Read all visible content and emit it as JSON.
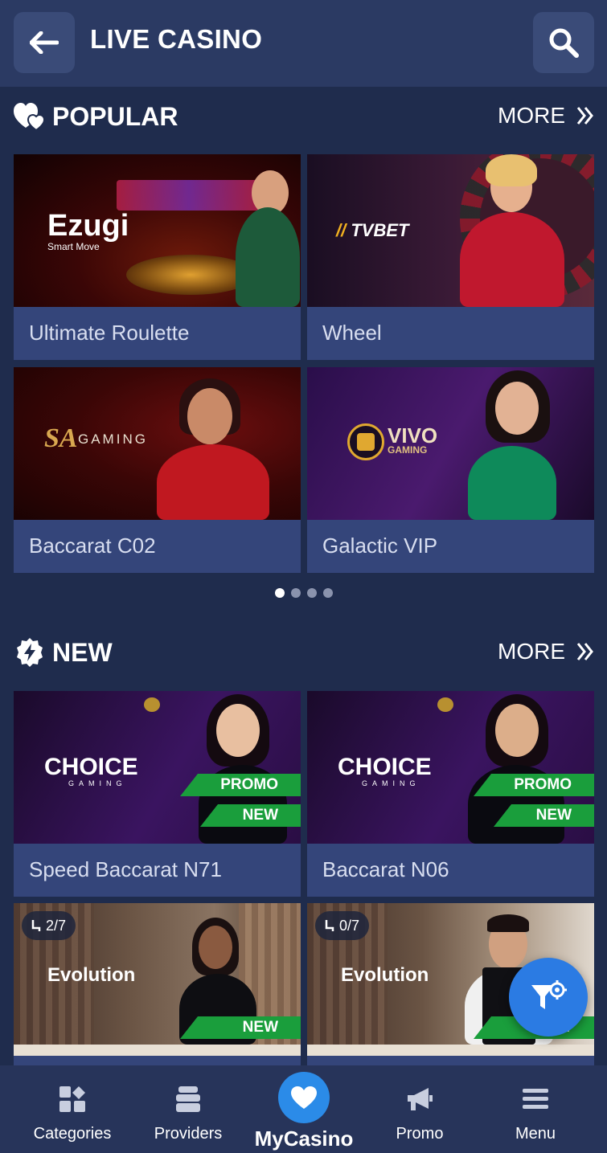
{
  "header": {
    "title": "LIVE CASINO"
  },
  "sections": {
    "popular": {
      "title": "POPULAR",
      "more_label": "MORE",
      "cards": [
        {
          "name": "Ultimate Roulette",
          "provider": "Ezugi",
          "provider_tagline": "Smart Move"
        },
        {
          "name": "Wheel",
          "provider": "TVBET"
        },
        {
          "name": "Baccarat C02",
          "provider": "GAMING",
          "provider_mark": "SA"
        },
        {
          "name": "Galactic VIP",
          "provider": "VIVO",
          "provider_sub": "GAMING"
        }
      ],
      "pagination": {
        "pages": 4,
        "current": 1
      }
    },
    "new": {
      "title": "NEW",
      "more_label": "MORE",
      "cards": [
        {
          "name": "Speed Baccarat N71",
          "provider": "CHOICE",
          "provider_sub": "GAMING",
          "badges": [
            "PROMO",
            "NEW"
          ]
        },
        {
          "name": "Baccarat N06",
          "provider": "CHOICE",
          "provider_sub": "GAMING",
          "badges": [
            "PROMO",
            "NEW"
          ]
        },
        {
          "name": "",
          "provider": "Evolution",
          "seats": "2/7",
          "badges": [
            "NEW"
          ]
        },
        {
          "name": "",
          "provider": "Evolution",
          "seats": "0/7",
          "badges": [
            "NEW"
          ]
        }
      ]
    }
  },
  "bottom_nav": [
    {
      "label": "Categories",
      "icon": "categories-icon"
    },
    {
      "label": "Providers",
      "icon": "providers-icon"
    },
    {
      "label": "MyCasino",
      "icon": "heart-icon"
    },
    {
      "label": "Promo",
      "icon": "megaphone-icon"
    },
    {
      "label": "Menu",
      "icon": "hamburger-icon"
    }
  ],
  "colors": {
    "background": "#1f2c4d",
    "header": "#2b3a63",
    "card": "#34457a",
    "accent_blue": "#2b7be3",
    "badge_green": "#1a9e3c"
  }
}
